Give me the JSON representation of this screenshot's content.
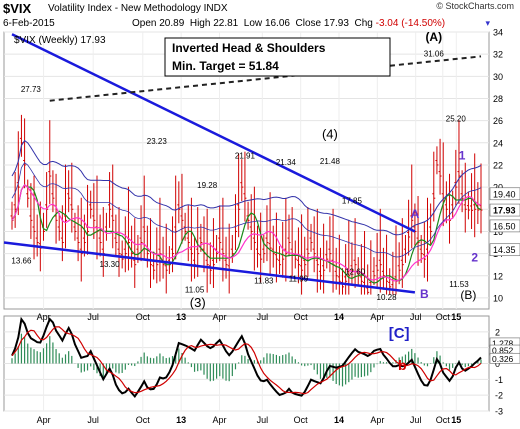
{
  "header": {
    "symbol": "$VIX",
    "description": "Volatility Index - New Methodology  INDX",
    "brand": "© StockCharts.com",
    "date": "6-Feb-2015",
    "open_label": "Open",
    "open": "20.89",
    "high_label": "High",
    "high": "22.81",
    "low_label": "Low",
    "low": "16.06",
    "close_label": "Close",
    "close": "17.93",
    "chg_label": "Chg",
    "chg": "-3.04 (-14.50%)",
    "dropdown": "▾"
  },
  "chart_data": [
    {
      "type": "candlestick",
      "legend": "$VIX (Weekly) 17.93",
      "ylim": [
        9,
        34
      ],
      "yticks": [
        10,
        12,
        14,
        16,
        18,
        20,
        22,
        24,
        26,
        28,
        30,
        32,
        34
      ],
      "xticks": [
        "Apr",
        "Jul",
        "Oct",
        "13",
        "Apr",
        "Jul",
        "Oct",
        "14",
        "Apr",
        "Jul",
        "Oct",
        "15"
      ],
      "price_labels": [
        "27.73",
        "23.23",
        "19.28",
        "21.91",
        "21.34",
        "21.48",
        "17.85",
        "13.66",
        "13.30",
        "11.05",
        "11.83",
        "11.99",
        "12.60",
        "10.28",
        "31.06",
        "25.20",
        "11.53"
      ],
      "right_axis_values": [
        "19.40",
        "17.93",
        "16.50",
        "14.35"
      ],
      "annotation_title": "Inverted Head & Shoulders",
      "annotation_target": "Min. Target = 51.84",
      "wave_labels": [
        "(A)",
        "(4)",
        "A",
        "B",
        "(3)",
        "(B)",
        "1",
        "2"
      ],
      "waves": {
        "A": "(A)",
        "W4": "(4)",
        "a": "A",
        "b": "B",
        "W3": "(3)",
        "B": "(B)",
        "one": "1",
        "two": "2"
      },
      "series": [
        {
          "name": "$VIX (Weekly)",
          "color": "#d00000"
        }
      ],
      "colors": {
        "candle": "#d00000",
        "ma_short": "#1a8a1a",
        "ma_mid": "#ff33cc",
        "band": "#3333aa",
        "trend": "#1a1adc"
      }
    },
    {
      "type": "histogram",
      "ylim": [
        -3,
        3
      ],
      "yticks": [
        -3,
        -2,
        -1,
        0,
        1,
        2
      ],
      "right_axis_values": [
        "1.278",
        "0.852",
        "0.326"
      ],
      "wave_labels": [
        "[C]",
        "b"
      ],
      "waves": {
        "C": "[C]",
        "b": "b"
      },
      "colors": {
        "hist": "#2e8b57",
        "line1": "#000000",
        "line2": "#d00000"
      }
    }
  ]
}
